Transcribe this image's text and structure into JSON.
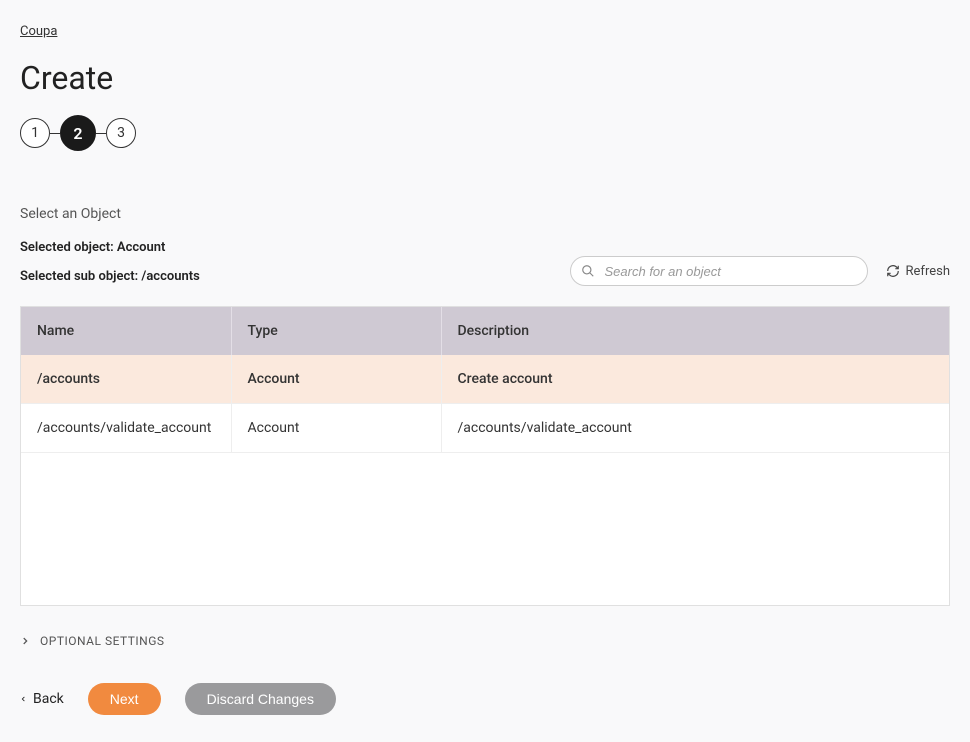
{
  "breadcrumb": "Coupa",
  "page_title": "Create",
  "stepper": {
    "steps": [
      "1",
      "2",
      "3"
    ],
    "active_index": 1
  },
  "section_label": "Select an Object",
  "selected_object_label": "Selected object: Account",
  "selected_sub_object_label": "Selected sub object: /accounts",
  "search": {
    "placeholder": "Search for an object"
  },
  "refresh_label": "Refresh",
  "table": {
    "headers": {
      "name": "Name",
      "type": "Type",
      "description": "Description"
    },
    "rows": [
      {
        "name": "/accounts",
        "type": "Account",
        "description": "Create account",
        "selected": true
      },
      {
        "name": "/accounts/validate_account",
        "type": "Account",
        "description": "/accounts/validate_account",
        "selected": false
      }
    ]
  },
  "optional_settings_label": "OPTIONAL SETTINGS",
  "footer": {
    "back": "Back",
    "next": "Next",
    "discard": "Discard Changes"
  }
}
